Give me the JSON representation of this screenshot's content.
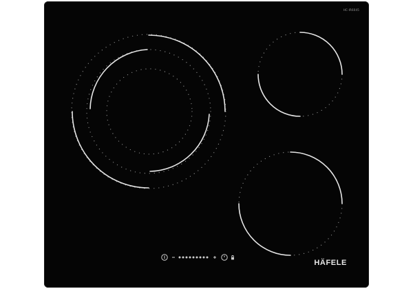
{
  "appliance": {
    "model_code": "HC-IR6045",
    "brand_logo": "HÄFELE",
    "colors": {
      "glass": "#050505",
      "heating_ring": "#e6e6e6",
      "dot_marking": "#8a8a8a",
      "controls": "#cfcfcf"
    }
  },
  "controls": {
    "icons": [
      "power-icon",
      "minus-icon",
      "power-level-slider",
      "plus-icon",
      "timer-icon",
      "lock-icon"
    ],
    "power_levels": 9
  }
}
